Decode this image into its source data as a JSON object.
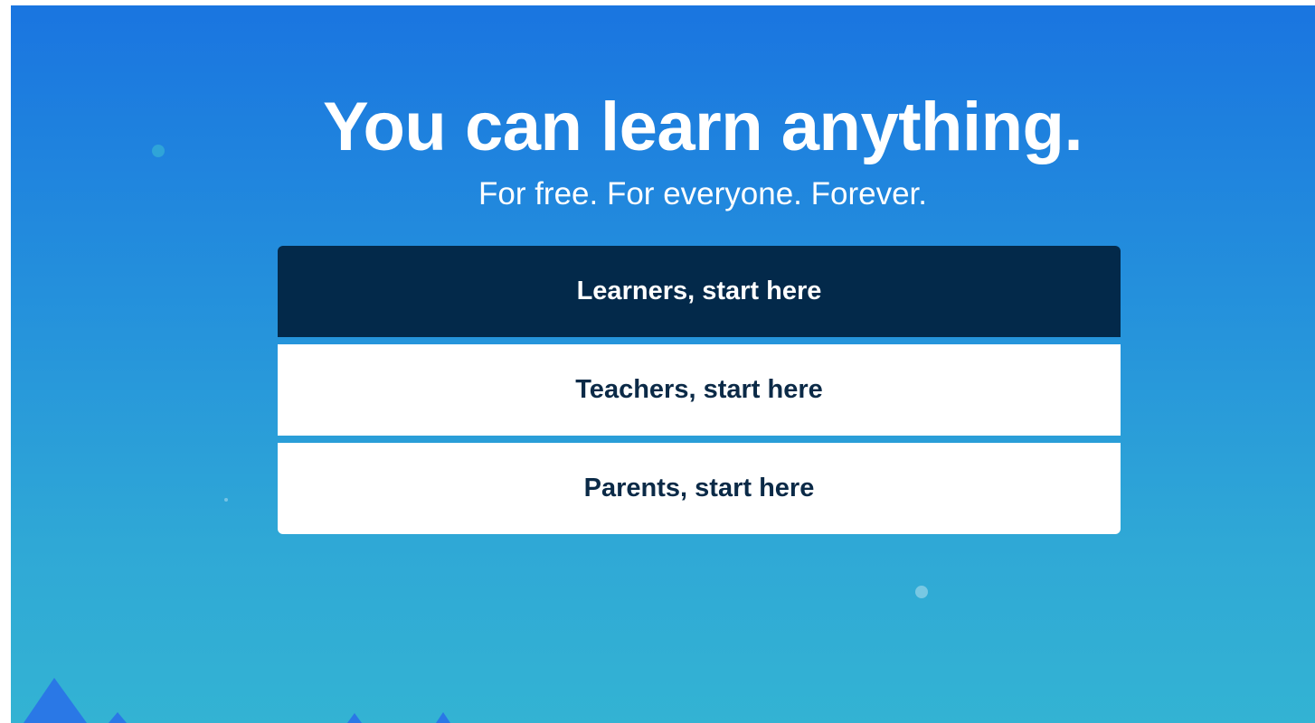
{
  "hero": {
    "title": "You can learn anything.",
    "subtitle": "For free. For everyone. Forever."
  },
  "cta": {
    "learners": "Learners, start here",
    "teachers": "Teachers, start here",
    "parents": "Parents, start here"
  },
  "colors": {
    "background_top": "#1a75e0",
    "background_bottom": "#33b3d3",
    "primary_button": "#03294a",
    "secondary_button": "#ffffff",
    "text_dark": "#0b2a47"
  },
  "decorations": [
    "floating-dot",
    "floating-dot",
    "floating-dot",
    "mountain-shapes"
  ]
}
